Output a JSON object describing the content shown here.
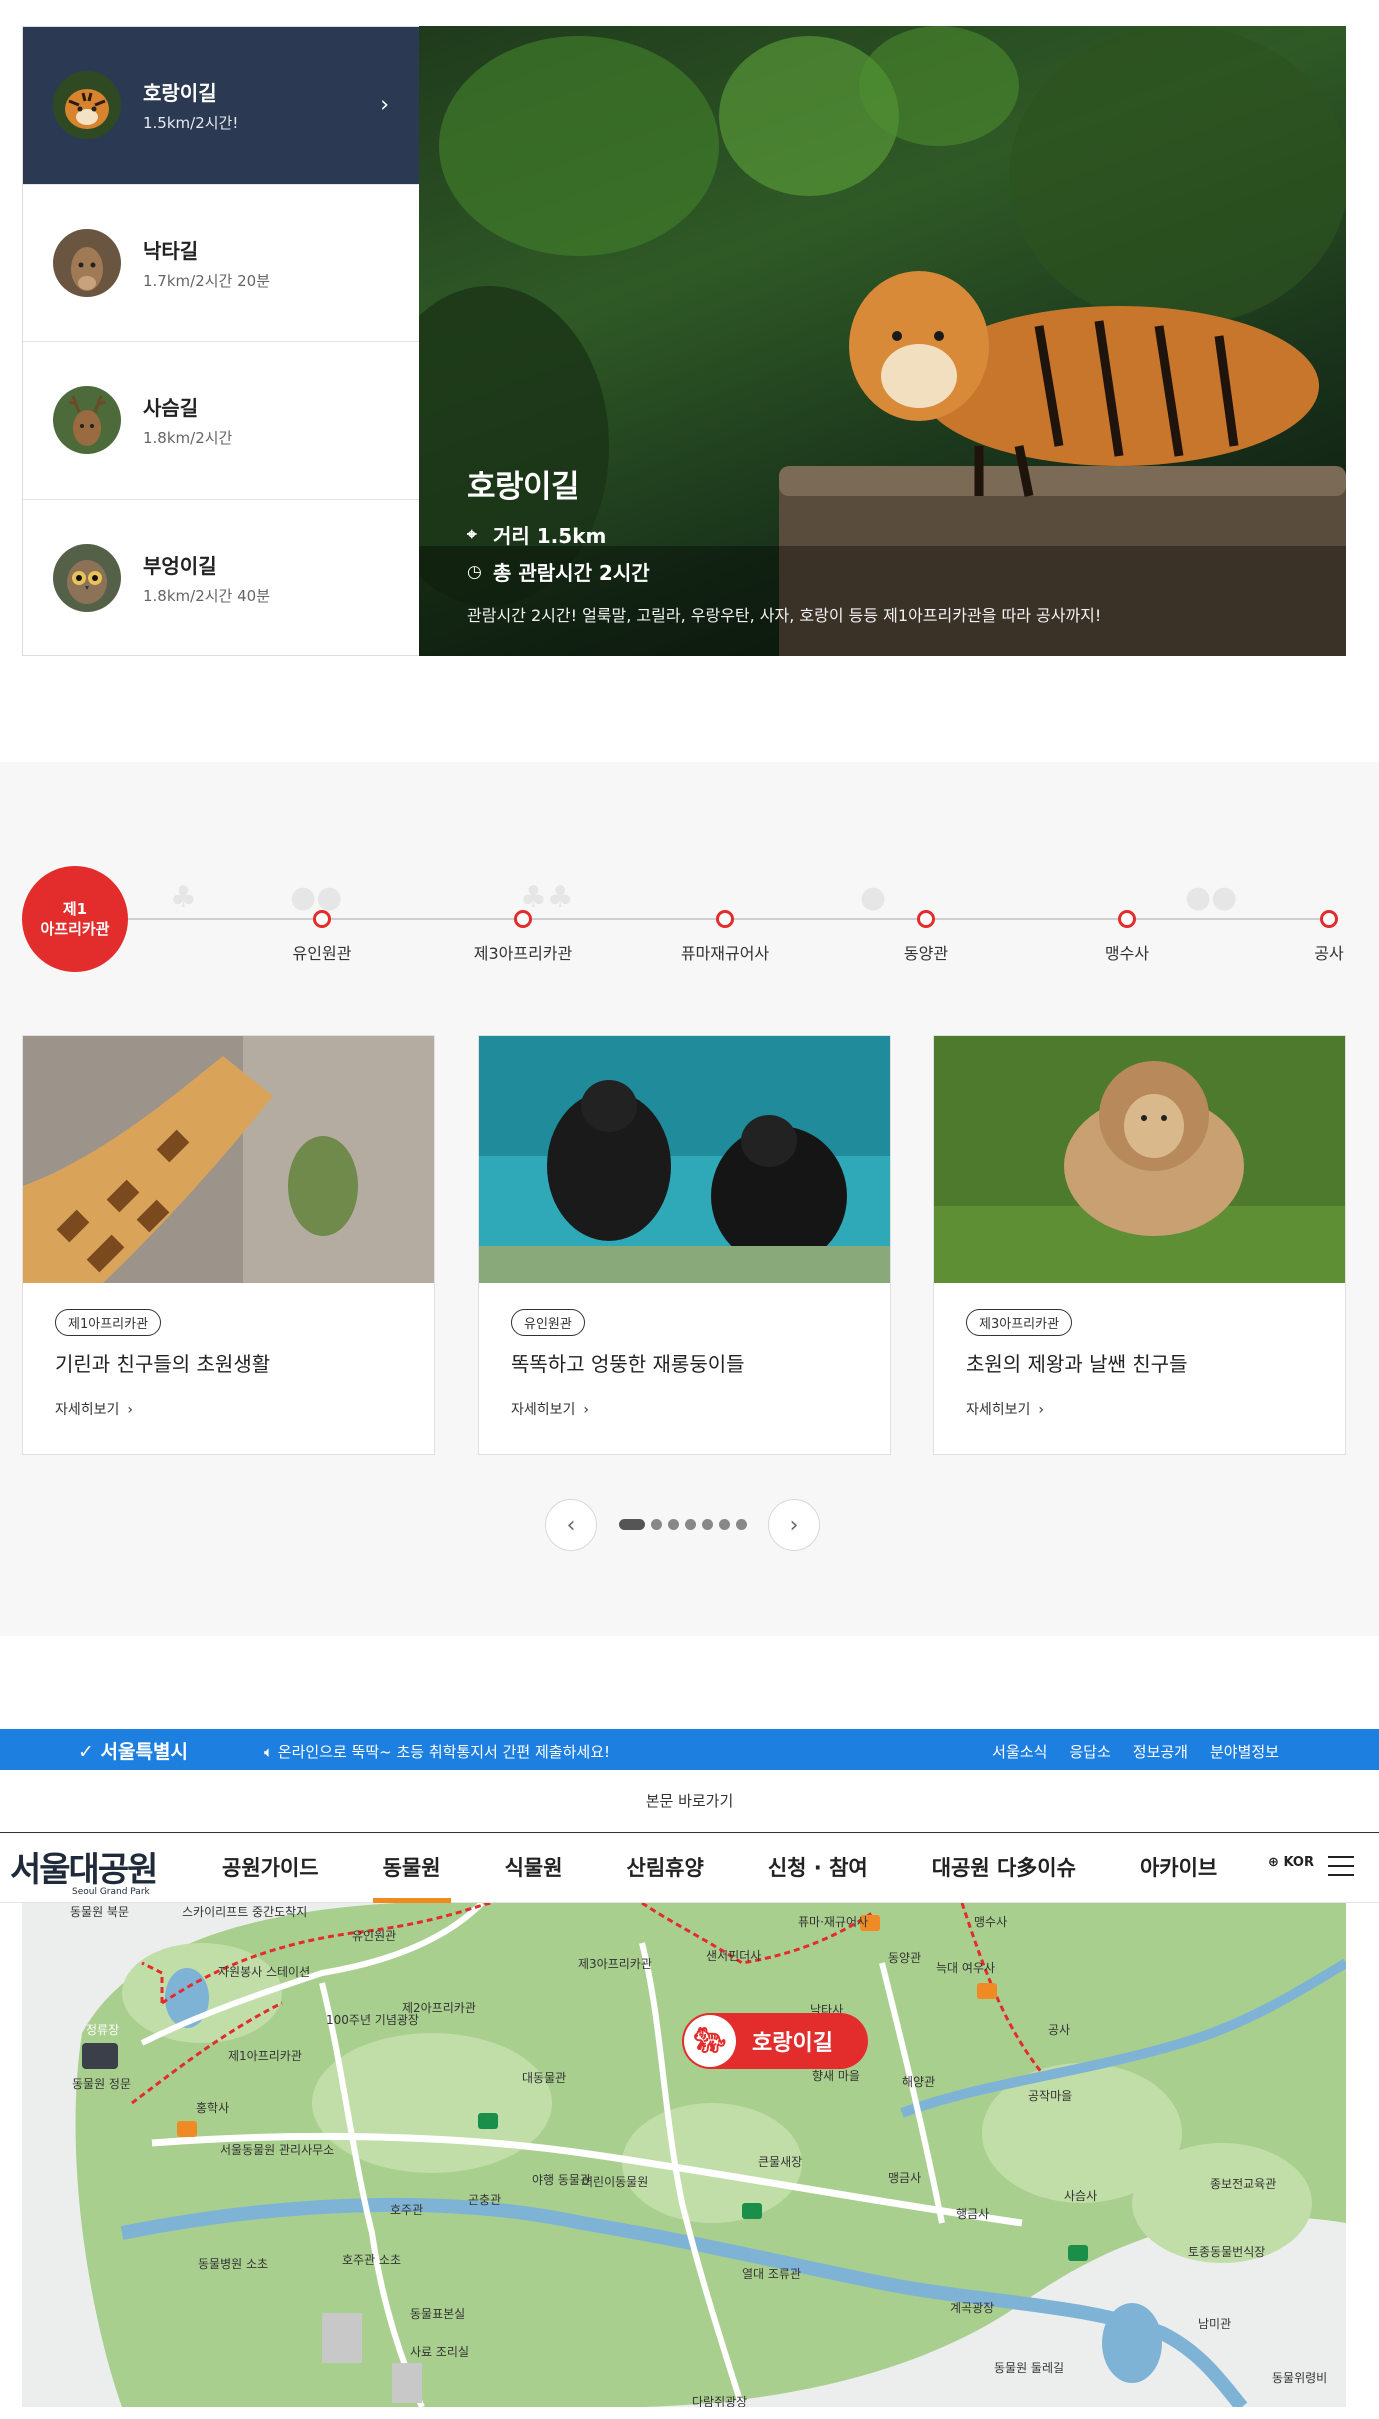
{
  "trails": {
    "items": [
      {
        "name": "호랑이길",
        "meta": "1.5km/2시간!"
      },
      {
        "name": "낙타길",
        "meta": "1.7km/2시간 20분"
      },
      {
        "name": "사슴길",
        "meta": "1.8km/2시간"
      },
      {
        "name": "부엉이길",
        "meta": "1.8km/2시간 40분"
      }
    ],
    "active_arrow": "›",
    "hero": {
      "title": "호랑이길",
      "distance": "거리 1.5km",
      "time": "총 관람시간 2시간",
      "desc": "관람시간 2시간! 얼룩말, 고릴라, 우랑우탄, 사자, 호랑이 등등 제1아프리카관을 따라 공사까지!",
      "distance_icon": "map-pin-icon",
      "time_icon": "clock-icon"
    }
  },
  "route": {
    "start_line1": "제1",
    "start_line2": "아프리카관",
    "stops": [
      "유인원관",
      "제3아프리카관",
      "퓨마재규어사",
      "동양관",
      "맹수사",
      "공사"
    ]
  },
  "cards": [
    {
      "tag": "제1아프리카관",
      "title": "기린과 친구들의 초원생활",
      "more": "자세히보기"
    },
    {
      "tag": "유인원관",
      "title": "똑똑하고 엉뚱한 재롱둥이들",
      "more": "자세히보기"
    },
    {
      "tag": "제3아프리카관",
      "title": "초원의 제왕과 날쌘 친구들",
      "more": "자세히보기"
    }
  ],
  "pager": {
    "prev": "‹",
    "next": "›",
    "total": 7,
    "current": 1
  },
  "seoul_bar": {
    "logo": "서울특별시",
    "notice": "온라인으로 뚝딱~ 초등 취학통지서 간편 제출하세요!",
    "links": [
      "서울소식",
      "응답소",
      "정보공개",
      "분야별정보"
    ]
  },
  "skip_link": "본문 바로가기",
  "header": {
    "brand_ko": "서울대공원",
    "brand_en": "Seoul Grand Park",
    "nav": [
      "공원가이드",
      "동물원",
      "식물원",
      "산림휴양",
      "신청 · 참여",
      "대공원 다多이슈",
      "아카이브"
    ],
    "active_nav": 1,
    "lang": "KOR"
  },
  "map": {
    "badge": "호랑이길",
    "labels": [
      "동물원 북문",
      "스카이리프트 중간도착지",
      "유인원관",
      "퓨마·재규어사",
      "맹수사",
      "자원봉사 스테이션",
      "제3아프리카관",
      "샌서핀더사",
      "동양관",
      "늑대 여우사",
      "정류장",
      "100주년 기념광장",
      "제2아프리카관",
      "낙타사",
      "공사",
      "제1아프리카관",
      "대동물관",
      "향새 마을",
      "해양관",
      "공작마을",
      "동물원 정문",
      "홍학사",
      "큰물새장",
      "서울동물원 관리사무소",
      "맹금사",
      "사슴사",
      "종보전교육관",
      "호주관",
      "곤충관",
      "야행 동물관",
      "어린이동물원",
      "행금사",
      "토종동물번식장",
      "동물병원 소초",
      "호주관 소초",
      "열대 조류관",
      "계곡광장",
      "동물표본실",
      "사료 조리실",
      "남미관",
      "동물원 둘레길",
      "동물위령비",
      "다람쥐광장"
    ]
  },
  "colors": {
    "accent_red": "#e32c2c",
    "navy": "#2b3a52",
    "seoul_blue": "#1d7fe0",
    "nav_underline": "#ef8a1f"
  }
}
